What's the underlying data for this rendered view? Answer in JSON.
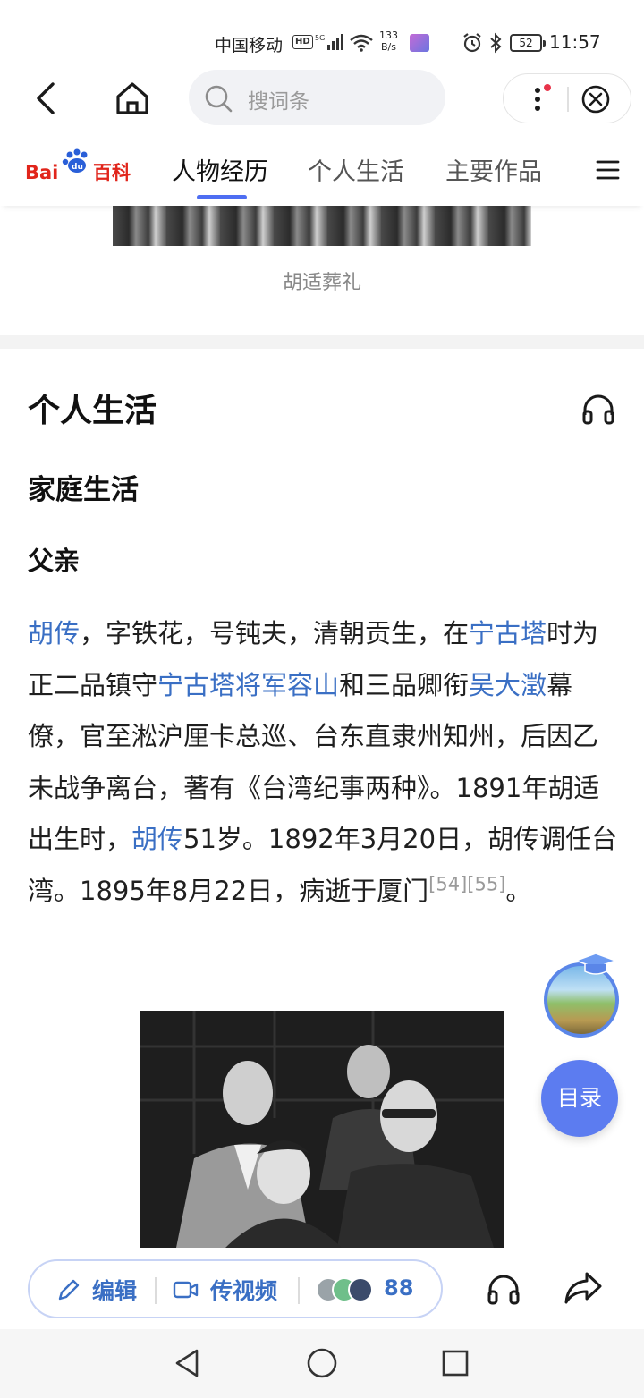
{
  "status_bar": {
    "carrier": "中国移动",
    "hd": "HD",
    "net_speed_value": "133",
    "net_speed_unit": "B/s",
    "battery": "52",
    "time": "11:57"
  },
  "search": {
    "placeholder": "搜词条"
  },
  "baike": {
    "logo_text": "Bai百科",
    "tabs": [
      "人物经历",
      "个人生活",
      "主要作品"
    ],
    "active_tab": 0
  },
  "prev_photo_caption": "胡适葬礼",
  "section": {
    "title": "个人生活",
    "subtitle": "家庭生活",
    "subsubtitle": "父亲"
  },
  "paragraph": {
    "s1_link": "胡传",
    "s1_text": "，字铁花，号钝夫，清朝贡生，在",
    "s2_link": "宁古塔",
    "s2_text": "时为正二品镇守",
    "s3_link": "宁古塔将军容山",
    "s3_text": "和三品卿衔",
    "s4_link": "吴大澂",
    "s4_text": "幕僚，官至淞沪厘卡总巡、台东直隶州知州，后因乙未战争离台，著有《台湾纪事两种》。1891年胡适出生时，",
    "s5_link": "胡传",
    "s5_text": "51岁。1892年3月20日，胡传调任台湾。1895年8月22日，病逝于厦门",
    "ref1": "[54]",
    "ref2": "[55]",
    "end": "。"
  },
  "float": {
    "toc_label": "目录"
  },
  "bottom_bar": {
    "edit_label": "编辑",
    "video_label": "传视频",
    "contributor_count": "88"
  },
  "colors": {
    "link": "#3a6fc4",
    "accent": "#4e6ef2",
    "toc_button": "#5c7cf0"
  }
}
